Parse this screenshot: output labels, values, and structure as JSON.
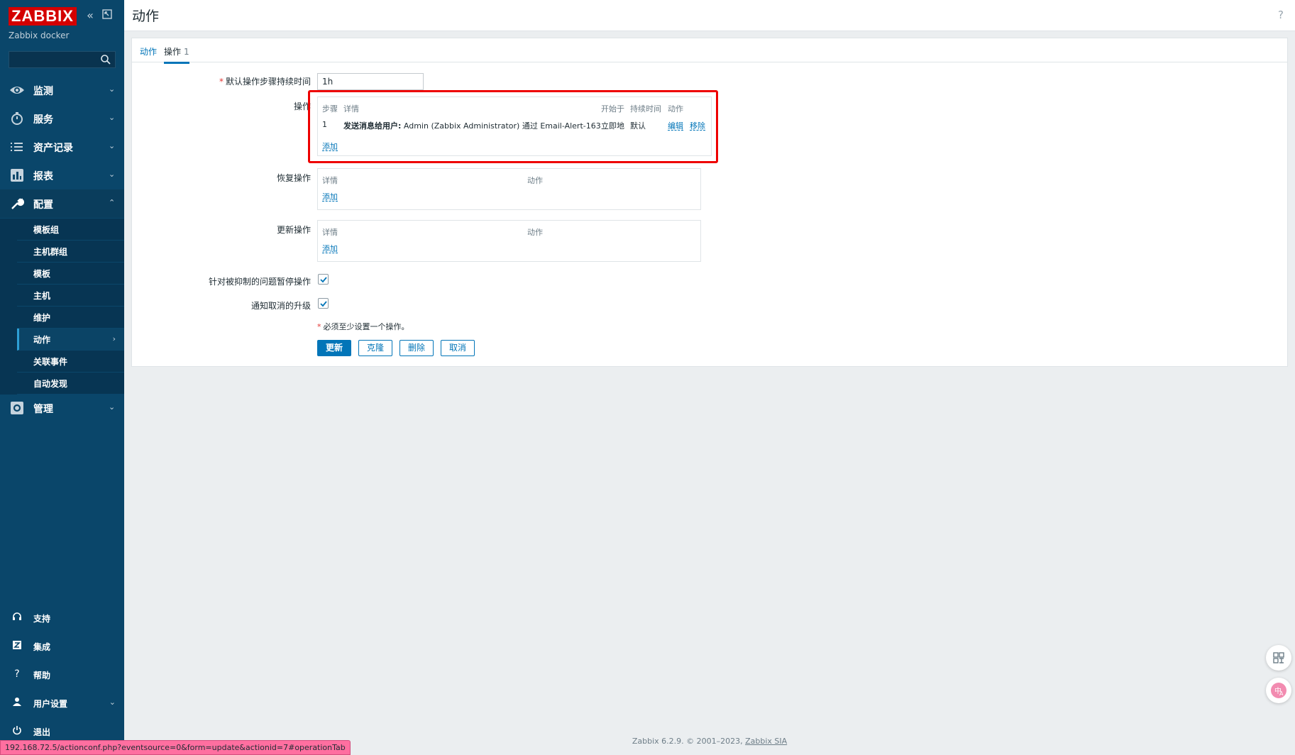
{
  "sidebar": {
    "logo": "ZABBIX",
    "server_name": "Zabbix docker",
    "menu": [
      {
        "label": "监测"
      },
      {
        "label": "服务"
      },
      {
        "label": "资产记录"
      },
      {
        "label": "报表"
      },
      {
        "label": "配置"
      },
      {
        "label": "管理"
      }
    ],
    "config_submenu": [
      "模板组",
      "主机群组",
      "模板",
      "主机",
      "维护",
      "动作",
      "关联事件",
      "自动发现"
    ],
    "bottom": [
      {
        "label": "支持",
        "icon": "headset-icon"
      },
      {
        "label": "集成",
        "icon": "zabbix-z-icon"
      },
      {
        "label": "帮助",
        "icon": "question-icon"
      },
      {
        "label": "用户设置",
        "icon": "user-icon"
      },
      {
        "label": "退出",
        "icon": "power-icon"
      }
    ]
  },
  "header": {
    "title": "动作",
    "help": "?"
  },
  "tabs": [
    {
      "label": "动作"
    },
    {
      "label": "操作",
      "count": "1"
    }
  ],
  "form": {
    "default_duration_label": "默认操作步骤持续时间",
    "default_duration_value": "1h",
    "operations_label": "操作",
    "operations_table": {
      "headers": [
        "步骤",
        "详情",
        "开始于",
        "持续时间",
        "动作"
      ],
      "rows": [
        {
          "step": "1",
          "detail_bold": "发送消息给用户:",
          "detail_rest": " Admin (Zabbix Administrator) 通过 Email-Alert-163",
          "start": "立即地",
          "duration": "默认",
          "edit": "编辑",
          "remove": "移除"
        }
      ],
      "add": "添加"
    },
    "recovery_label": "恢复操作",
    "recovery_table": {
      "headers": [
        "详情",
        "动作"
      ],
      "add": "添加"
    },
    "update_label": "更新操作",
    "update_table": {
      "headers": [
        "详情",
        "动作"
      ],
      "add": "添加"
    },
    "pause_suppressed_label": "针对被抑制的问题暂停操作",
    "pause_suppressed_checked": true,
    "notify_cancel_label": "通知取消的升级",
    "notify_cancel_checked": true,
    "required_note": "必须至少设置一个操作。",
    "required_star": "*",
    "buttons": {
      "update": "更新",
      "clone": "克隆",
      "delete": "删除",
      "cancel": "取消"
    }
  },
  "footer": {
    "text": "Zabbix 6.2.9. © 2001–2023, ",
    "link": "Zabbix SIA"
  },
  "status_url": "192.168.72.5/actionconf.php?eventsource=0&form=update&actionid=7#operationTab",
  "colors": {
    "sidebar": "#0a466a",
    "accent": "#0275b8",
    "logo": "#d40000",
    "highlight": "#ee0000"
  }
}
